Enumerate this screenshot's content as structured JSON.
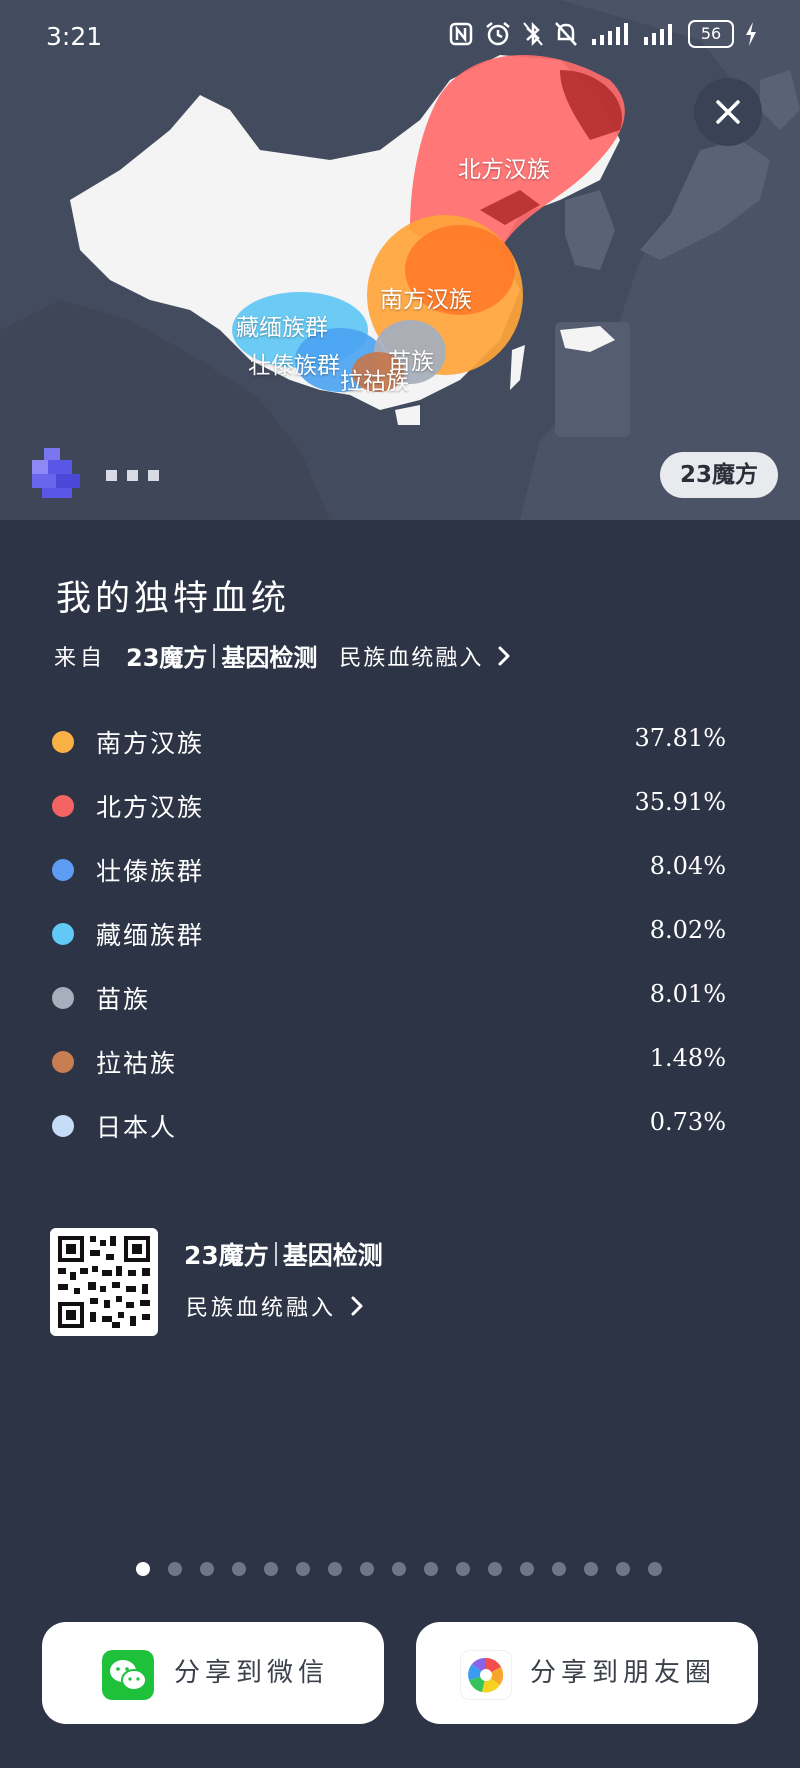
{
  "status_bar": {
    "time": "3:21",
    "battery": "56",
    "icons": [
      "nfc-icon",
      "alarm-icon",
      "bluetooth-icon",
      "mute-icon",
      "signal-icon",
      "signal-icon",
      "battery-icon",
      "charging-icon"
    ]
  },
  "map": {
    "regions": [
      {
        "label": "北方汉族",
        "color": "#ff6b6b"
      },
      {
        "label": "南方汉族",
        "color": "#ffa43a"
      },
      {
        "label": "藏缅族群",
        "color": "#5cc7f5"
      },
      {
        "label": "壮傣族群",
        "color": "#4aa3f2"
      },
      {
        "label": "苗族",
        "color": "#a8aebc"
      },
      {
        "label": "拉祜族",
        "color": "#c6764a"
      }
    ],
    "brand_badge": "23魔方"
  },
  "report": {
    "title": "我的独特血统",
    "from_label": "来自",
    "brand": "23魔方",
    "brand_sub": "基因检测",
    "link": "民族血统融入"
  },
  "ancestry": [
    {
      "name": "南方汉族",
      "percent": "37.81%",
      "color": "#f9b045"
    },
    {
      "name": "北方汉族",
      "percent": "35.91%",
      "color": "#f46463"
    },
    {
      "name": "壮傣族群",
      "percent": "8.04%",
      "color": "#5d9cf2"
    },
    {
      "name": "藏缅族群",
      "percent": "8.02%",
      "color": "#62c8f5"
    },
    {
      "name": "苗族",
      "percent": "8.01%",
      "color": "#a7afbd"
    },
    {
      "name": "拉祜族",
      "percent": "1.48%",
      "color": "#c87d52"
    },
    {
      "name": "日本人",
      "percent": "0.73%",
      "color": "#c6ddf8"
    }
  ],
  "qr_block": {
    "brand": "23魔方",
    "brand_sub": "基因检测",
    "link": "民族血统融入"
  },
  "pager": {
    "total": 17,
    "active": 0
  },
  "share": {
    "wechat_label": "分享到微信",
    "moments_label": "分享到朋友圈"
  },
  "colors": {
    "background": "#2c3446",
    "map_background": "#434b5e",
    "accent_white": "#ffffff"
  }
}
